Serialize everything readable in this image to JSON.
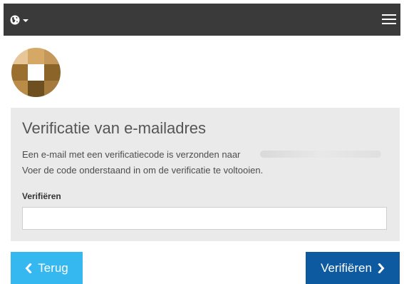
{
  "navbar": {
    "language_icon": "globe-icon",
    "menu_icon": "hamburger-icon",
    "background": "#3a3a3a"
  },
  "logo": {
    "colors": [
      "#e7c79a",
      "#d6a865",
      "#c4975b",
      "#9b6f2e",
      "#ffffff",
      "#8a6428",
      "#bb8c48",
      "#6e4f1f",
      "#a57b3d"
    ]
  },
  "form": {
    "title": "Verificatie van e-mailadres",
    "message_line1": "Een e-mail met een verificatiecode is verzonden naar",
    "message_line2": "Voer de code onderstaand in om de verificatie te voltooien.",
    "code_label": "Verifiëren",
    "code_value": ""
  },
  "buttons": {
    "back_label": "Terug",
    "back_icon": "chevron-left-icon",
    "back_color": "#35b8f0",
    "verify_label": "Verifiëren",
    "verify_icon": "chevron-right-icon",
    "verify_color": "#0e5aa0"
  }
}
